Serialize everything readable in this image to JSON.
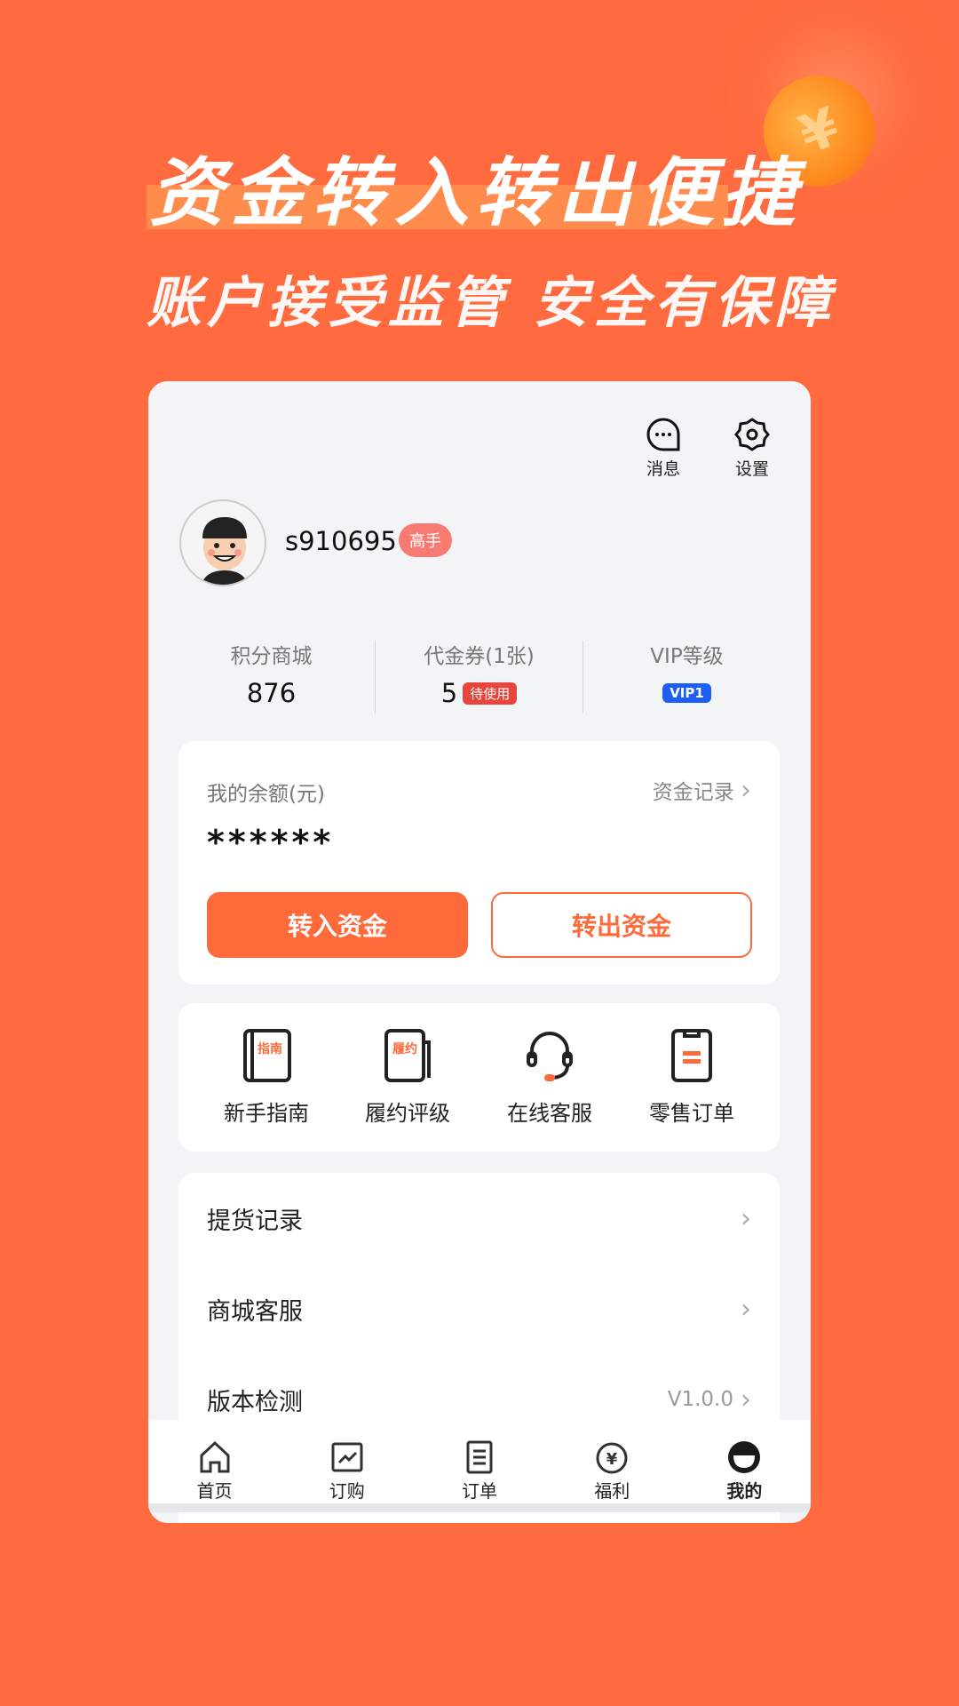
{
  "promo": {
    "headline": "资金转入转出便捷",
    "subline": "账户接受监管 安全有保障",
    "coin_symbol": "¥"
  },
  "header": {
    "messages_label": "消息",
    "settings_label": "设置"
  },
  "profile": {
    "username": "s910695",
    "level_badge": "高手"
  },
  "stats": [
    {
      "label": "积分商城",
      "value": "876"
    },
    {
      "label": "代金券(1张)",
      "value": "5",
      "tag": "待使用"
    },
    {
      "label": "VIP等级",
      "tag": "VIP1"
    }
  ],
  "balance": {
    "label": "我的余额(元)",
    "link": "资金记录",
    "value": "******",
    "deposit": "转入资金",
    "withdraw": "转出资金"
  },
  "shortcuts": [
    {
      "label": "新手指南",
      "icon_text": "指南"
    },
    {
      "label": "履约评级",
      "icon_text": "履约"
    },
    {
      "label": "在线客服"
    },
    {
      "label": "零售订单"
    }
  ],
  "menu": [
    {
      "label": "提货记录"
    },
    {
      "label": "商城客服"
    },
    {
      "label": "版本检测",
      "value": "V1.0.0"
    }
  ],
  "nav": [
    {
      "label": "首页"
    },
    {
      "label": "订购"
    },
    {
      "label": "订单"
    },
    {
      "label": "福利"
    },
    {
      "label": "我的",
      "active": true
    }
  ],
  "colors": {
    "brand": "#ff6b3e",
    "accent": "#ff6a3a",
    "vip": "#1f5ef5",
    "pending": "#e8453c"
  }
}
